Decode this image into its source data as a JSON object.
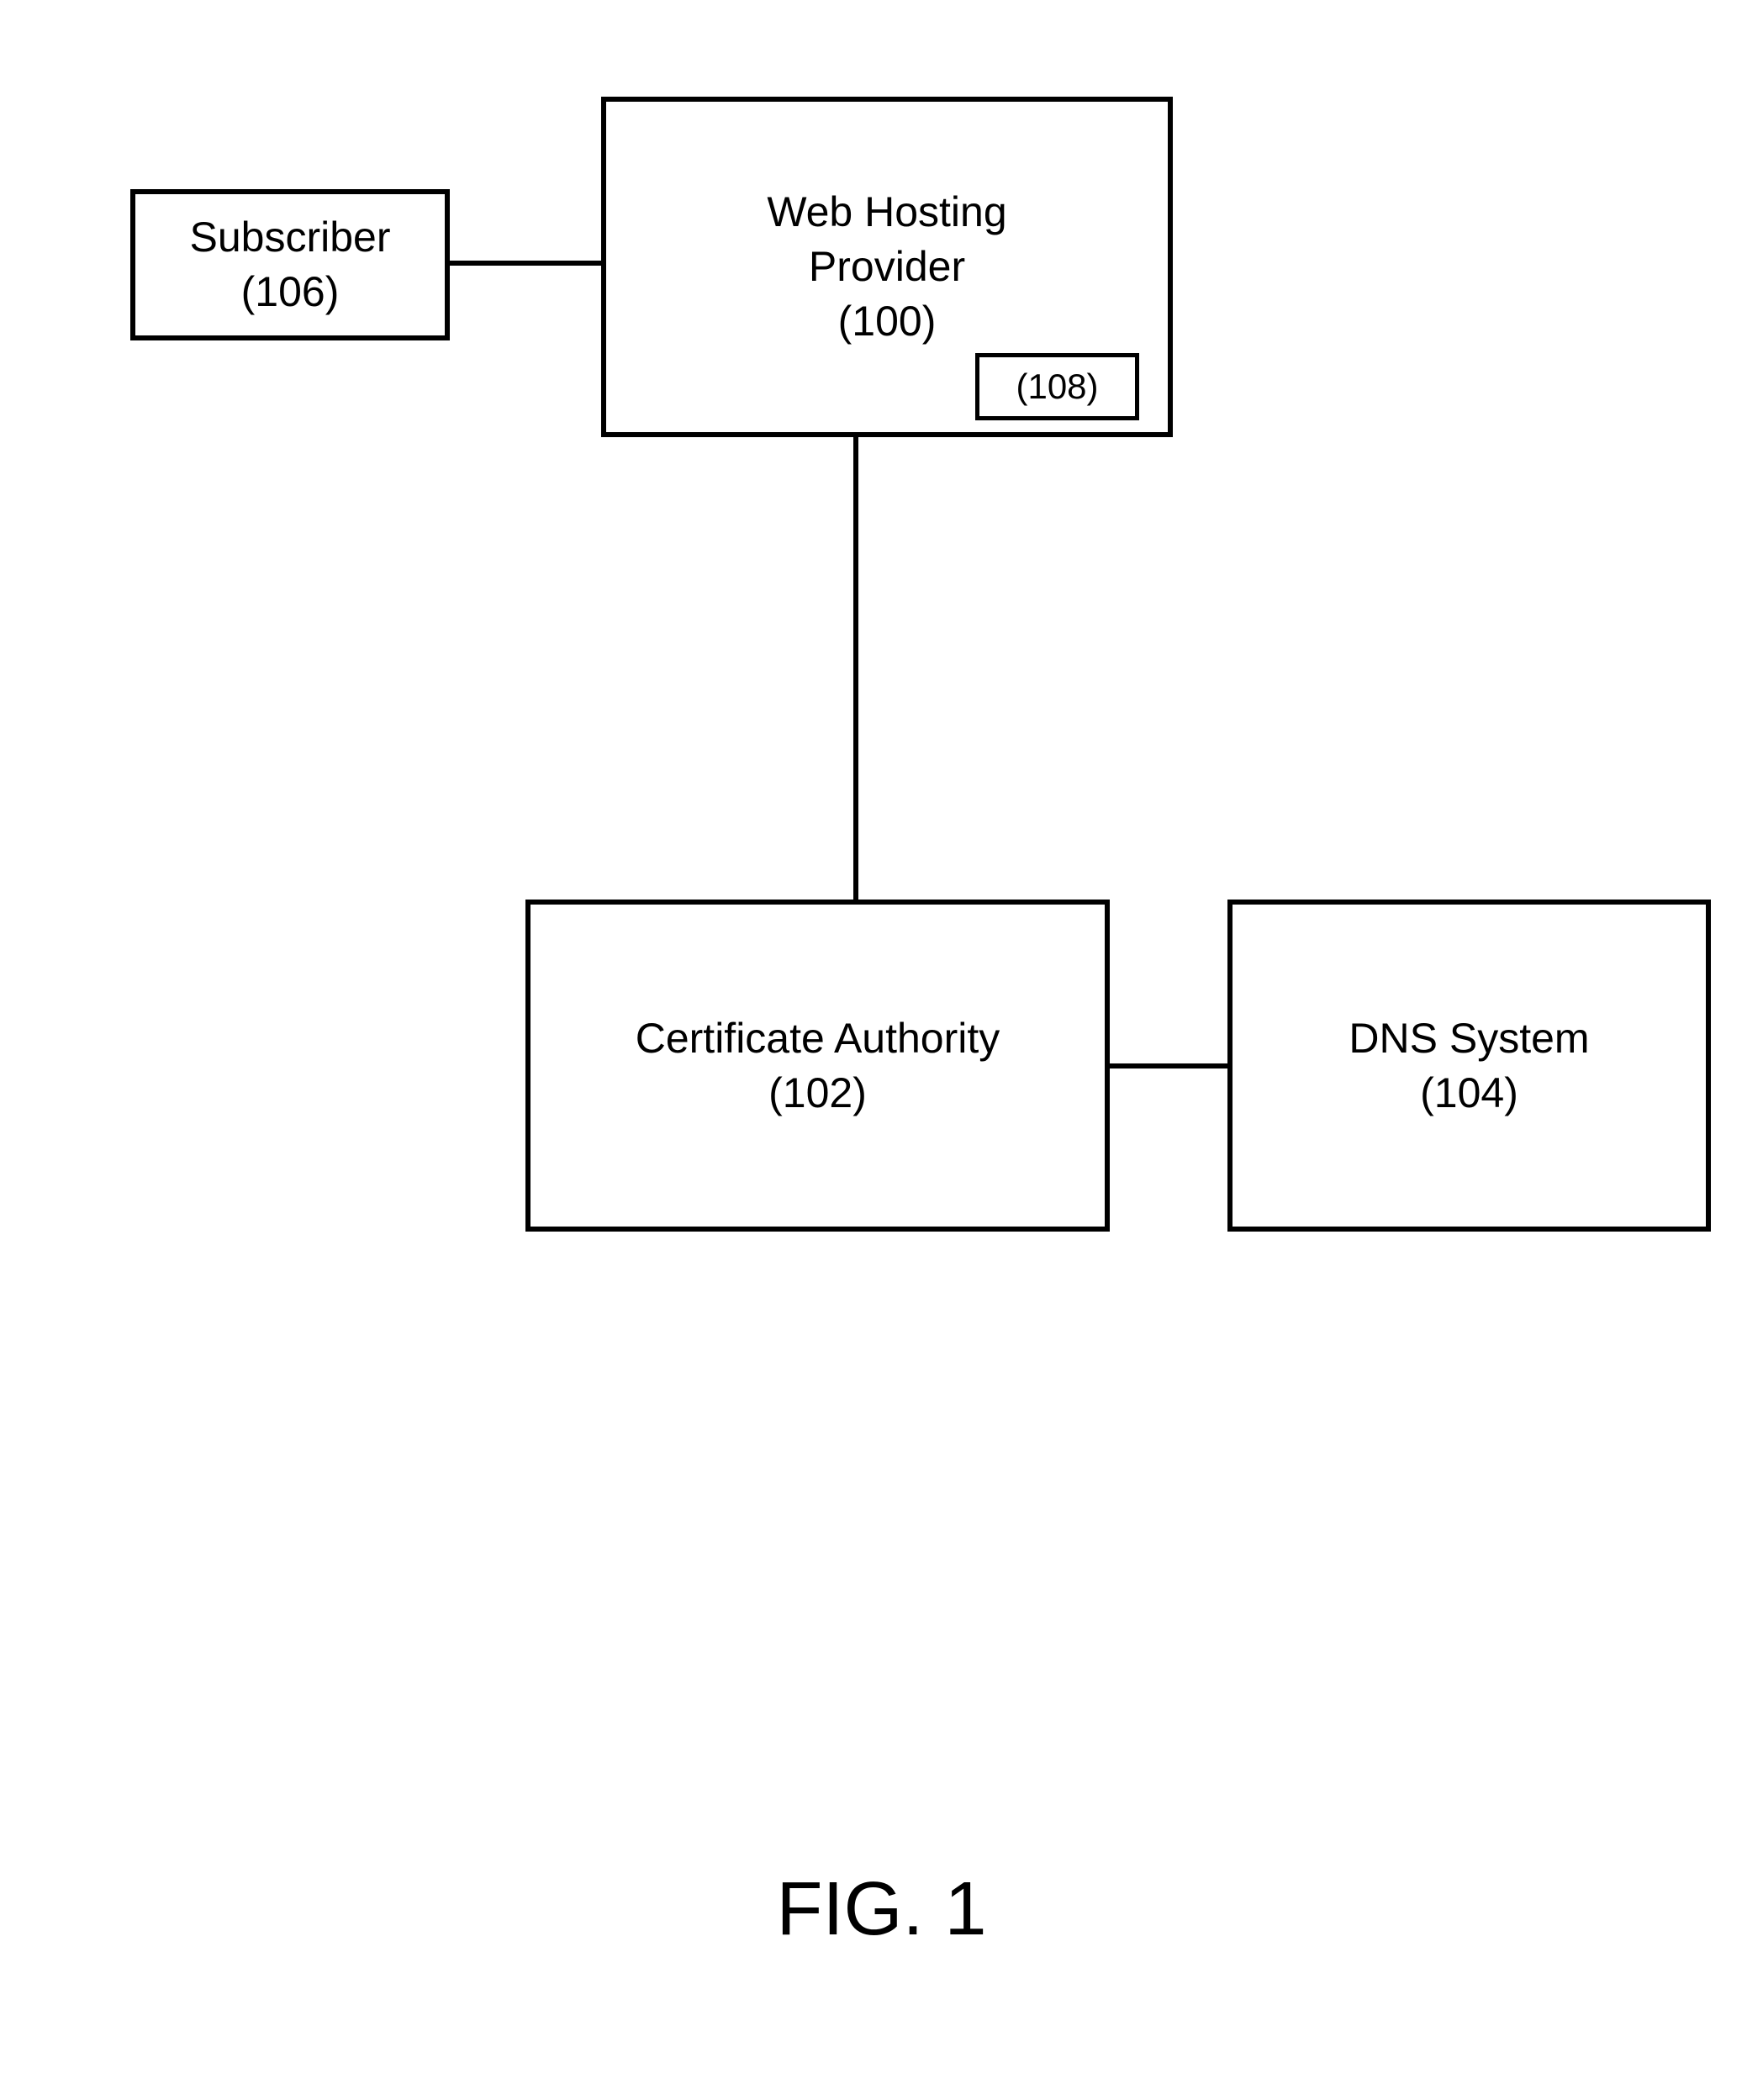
{
  "nodes": {
    "subscriber": {
      "label": "Subscriber",
      "ref": "(106)"
    },
    "webHosting": {
      "label1": "Web Hosting",
      "label2": "Provider",
      "ref": "(100)",
      "innerRef": "(108)"
    },
    "certAuthority": {
      "label": "Certificate Authority",
      "ref": "(102)"
    },
    "dnsSystem": {
      "label": "DNS System",
      "ref": "(104)"
    }
  },
  "figure": {
    "label": "FIG. 1"
  }
}
